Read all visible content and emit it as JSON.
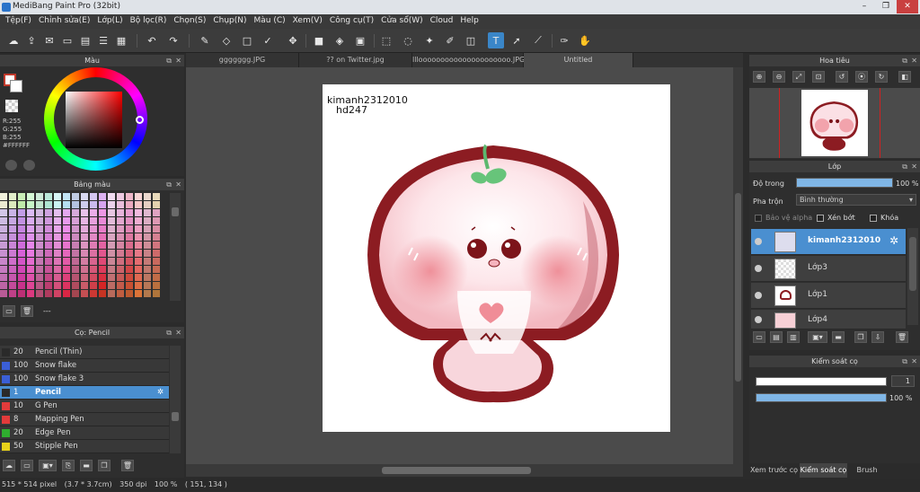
{
  "window": {
    "title": "MediBang Paint Pro (32bit)"
  },
  "menu": [
    "Tệp(F)",
    "Chỉnh sửa(E)",
    "Lớp(L)",
    "Bộ lọc(R)",
    "Chọn(S)",
    "Chụp(N)",
    "Màu (C)",
    "Xem(V)",
    "Công cụ(T)",
    "Cửa sổ(W)",
    "Cloud",
    "Help"
  ],
  "color_panel": {
    "title": "Màu",
    "r": "R:255",
    "g": "G:255",
    "b": "B:255",
    "hex": "#FFFFFF"
  },
  "palette_panel": {
    "title": "Bảng màu",
    "footer": "---"
  },
  "brush_panel": {
    "title": "Cọ: Pencil",
    "items": [
      {
        "size": "20",
        "name": "Pencil (Thin)",
        "color": "#2a2a2a"
      },
      {
        "size": "100",
        "name": "Snow flake",
        "color": "#3b5fd6"
      },
      {
        "size": "100",
        "name": "Snow flake 3",
        "color": "#3b5fd6"
      },
      {
        "size": "1",
        "name": "Pencil",
        "color": "#2a2a2a"
      },
      {
        "size": "10",
        "name": "G Pen",
        "color": "#e23b3b"
      },
      {
        "size": "8",
        "name": "Mapping Pen",
        "color": "#e23b3b"
      },
      {
        "size": "20",
        "name": "Edge Pen",
        "color": "#2fae2f"
      },
      {
        "size": "50",
        "name": "Stipple Pen",
        "color": "#e8d21a"
      }
    ]
  },
  "tabs": [
    "ggggggg.JPG",
    "?? on Twitter.jpg",
    "lllooooooooooooooooooooo.JPG",
    "Untitled"
  ],
  "canvas": {
    "text1": "kimanh2312010",
    "text2": "hd247"
  },
  "navigator": {
    "title": "Hoa tiêu"
  },
  "layer_panel": {
    "title": "Lớp",
    "opacity_label": "Độ trong",
    "opacity_value": "100 %",
    "blend_label": "Pha trộn",
    "blend_value": "Bình thường",
    "protect_alpha": "Bảo vệ alpha",
    "clip": "Xén bớt",
    "lock": "Khóa",
    "layers": [
      "kimanh2312010",
      "Lớp3",
      "Lớp1",
      "Lớp4"
    ]
  },
  "brush_control": {
    "title": "Kiểm soát cọ",
    "size_value": "1",
    "opacity_value": "100 %"
  },
  "bottom_tabs": [
    "Xem trước cọ",
    "Kiểm soát cọ",
    "Brush Size"
  ],
  "status": {
    "size": "515 * 514 pixel",
    "cm": "(3.7 * 3.7cm)",
    "dpi": "350 dpi",
    "zoom": "100 %",
    "coords": "( 151, 134 )"
  },
  "colors": {
    "accent": "#4a8fd0",
    "outline": "#8c1c22",
    "blush": "#ef8f98"
  }
}
